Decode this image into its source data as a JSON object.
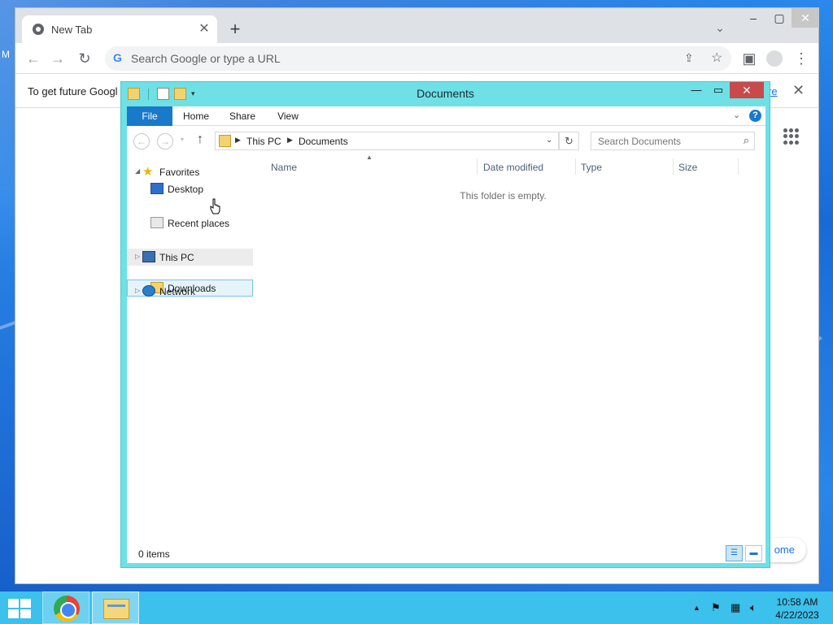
{
  "chrome": {
    "tab_title": "New Tab",
    "omnibox_placeholder": "Search Google or type a URL",
    "infobar_text": "To get future Googl",
    "infobar_link": "re",
    "customize_label": "ome"
  },
  "desktop": {
    "edge_label": "M"
  },
  "explorer": {
    "title": "Documents",
    "ribbon_tabs": [
      "File",
      "Home",
      "Share",
      "View"
    ],
    "breadcrumb": [
      "This PC",
      "Documents"
    ],
    "search_placeholder": "Search Documents",
    "nav": {
      "favorites": "Favorites",
      "desktop": "Desktop",
      "downloads": "Downloads",
      "recent": "Recent places",
      "this_pc": "This PC",
      "network": "Network"
    },
    "columns": [
      "Name",
      "Date modified",
      "Type",
      "Size"
    ],
    "empty_message": "This folder is empty.",
    "status": "0 items"
  },
  "taskbar": {
    "time": "10:58 AM",
    "date": "4/22/2023"
  },
  "colors": {
    "explorer_frame": "#6ee0e6",
    "file_tab": "#1979ca",
    "taskbar": "#3cc0ec",
    "close_button": "#c94a4a"
  }
}
